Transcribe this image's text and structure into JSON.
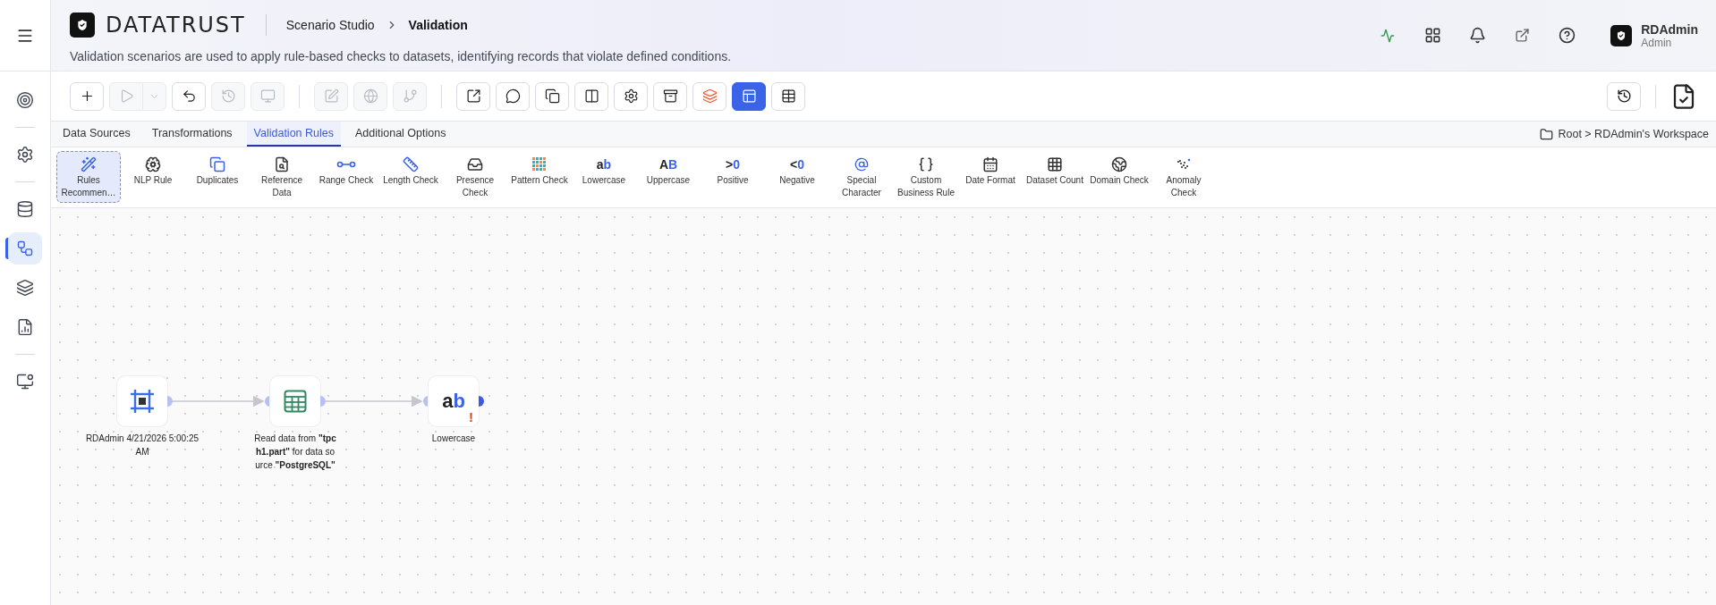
{
  "sidebar": {
    "items": [
      {
        "selected": false
      },
      {
        "selected": false
      },
      {
        "selected": false
      },
      {
        "selected": true
      },
      {
        "selected": false
      },
      {
        "selected": false
      },
      {
        "selected": false
      }
    ]
  },
  "header": {
    "logo": "DATATRUST",
    "breadcrumb": {
      "parent": "Scenario Studio",
      "current": "Validation"
    },
    "description": "Validation scenarios are used to apply rule-based checks to datasets, identifying records that violate defined conditions.",
    "user": {
      "name": "RDAdmin",
      "role": "Admin"
    }
  },
  "toolbar": {
    "buttons": [
      {
        "disabled": false,
        "selected": false
      },
      {
        "disabled": true,
        "selected": false
      },
      {
        "disabled": true,
        "selected": false
      },
      {
        "disabled": false,
        "selected": false
      },
      {
        "disabled": true,
        "selected": false
      },
      {
        "disabled": true,
        "selected": false
      },
      {
        "disabled": true,
        "selected": false
      },
      {
        "disabled": true,
        "selected": false
      },
      {
        "disabled": true,
        "selected": false
      },
      {
        "disabled": false,
        "selected": false
      },
      {
        "disabled": false,
        "selected": false
      },
      {
        "disabled": false,
        "selected": false
      },
      {
        "disabled": false,
        "selected": false
      },
      {
        "disabled": false,
        "selected": false
      },
      {
        "disabled": false,
        "selected": false
      },
      {
        "disabled": false,
        "selected": false
      },
      {
        "disabled": false,
        "selected": true
      },
      {
        "disabled": false,
        "selected": false
      }
    ]
  },
  "tabs": [
    {
      "label": "Data Sources",
      "selected": false
    },
    {
      "label": "Transformations",
      "selected": false
    },
    {
      "label": "Validation Rules",
      "selected": true
    },
    {
      "label": "Additional Options",
      "selected": false
    }
  ],
  "workspace_path": "Root > RDAdmin's Workspace",
  "rules": [
    {
      "kind": "icon",
      "label": "Rules Recommen…",
      "selected": true
    },
    {
      "kind": "icon",
      "label": "NLP Rule",
      "selected": false
    },
    {
      "kind": "icon",
      "label": "Duplicates",
      "selected": false
    },
    {
      "kind": "icon",
      "label": "Reference Data",
      "selected": false
    },
    {
      "kind": "icon",
      "label": "Range Check",
      "selected": false
    },
    {
      "kind": "icon",
      "label": "Length Check",
      "selected": false
    },
    {
      "kind": "icon",
      "label": "Presence Check",
      "selected": false
    },
    {
      "kind": "icon",
      "label": "Pattern Check",
      "selected": false
    },
    {
      "kind": "glyph",
      "glyph": "ab",
      "label": "Lowercase",
      "selected": false
    },
    {
      "kind": "glyph",
      "glyph": "AB",
      "label": "Uppercase",
      "selected": false
    },
    {
      "kind": "glyph",
      "glyph": ">0",
      "label": "Positive",
      "selected": false
    },
    {
      "kind": "glyph",
      "glyph": "<0",
      "label": "Negative",
      "selected": false
    },
    {
      "kind": "icon",
      "label": "Special Character",
      "selected": false
    },
    {
      "kind": "icon",
      "label": "Custom Business Rule",
      "selected": false
    },
    {
      "kind": "icon",
      "label": "Date Format",
      "selected": false
    },
    {
      "kind": "icon",
      "label": "Dataset Count",
      "selected": false
    },
    {
      "kind": "icon",
      "label": "Domain Check",
      "selected": false
    },
    {
      "kind": "icon",
      "label": "Anomaly Check",
      "selected": false
    }
  ],
  "canvas": {
    "nodes": [
      {
        "kind": "source",
        "label": "RDAdmin 4/21/2026 5:00:25 AM"
      },
      {
        "kind": "read",
        "label": "Read data from **\"tpch1.part\"** for data source **\"PostgreSQL\"**"
      },
      {
        "kind": "glyph",
        "glyph": "ab",
        "warning": "!",
        "label": "Lowercase"
      }
    ]
  }
}
